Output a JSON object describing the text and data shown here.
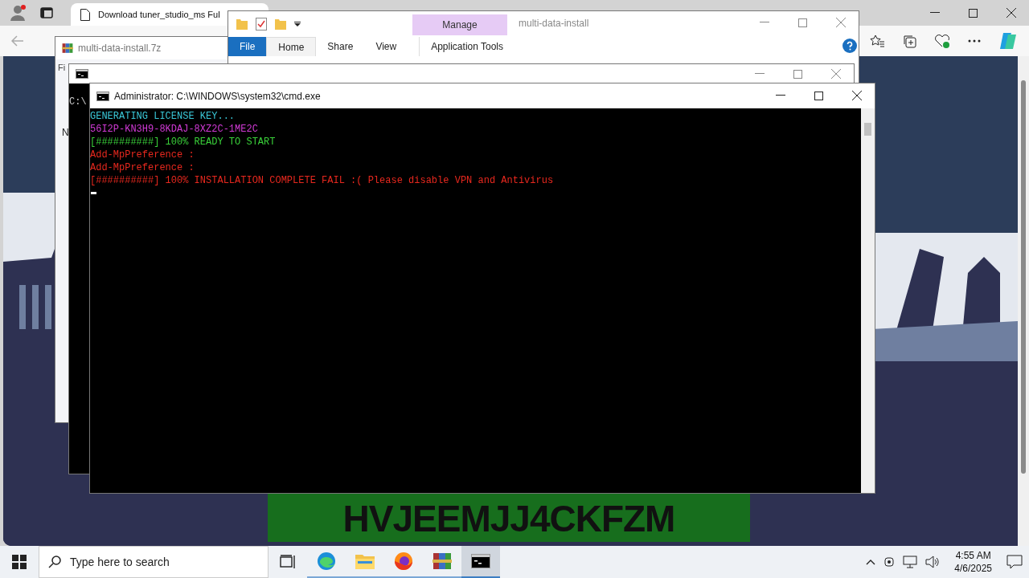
{
  "browser": {
    "tab": {
      "title": "Download tuner_studio_ms Ful"
    },
    "banner": {
      "text": "HVJEEMJJ4CKFZM"
    }
  },
  "archive_window": {
    "title": "multi-data-install.7z",
    "menu": "Fi",
    "column_1": "N"
  },
  "explorer_window": {
    "title": "multi-data-install",
    "context_tab": "Manage",
    "ribbon_tabs": [
      {
        "label": "File",
        "kind": "file",
        "selected": false
      },
      {
        "label": "Home",
        "kind": "tab",
        "selected": true
      },
      {
        "label": "Share",
        "kind": "tab",
        "selected": false
      },
      {
        "label": "View",
        "kind": "tab",
        "selected": false
      },
      {
        "label": "Application Tools",
        "kind": "context",
        "selected": false
      }
    ]
  },
  "back_console": {
    "text": "C:\\"
  },
  "console": {
    "title": "Administrator: C:\\WINDOWS\\system32\\cmd.exe",
    "lines": [
      {
        "text": "GENERATING LICENSE KEY...",
        "color": "#3ac8d8"
      },
      {
        "text": "56I2P-KN3H9-8KDAJ-8XZ2C-1ME2C",
        "color": "#d23ad6"
      },
      {
        "text": "[##########] 100% READY TO START",
        "color": "#3ad23a"
      },
      {
        "text": "Add-MpPreference :",
        "color": "#e8281e"
      },
      {
        "text": "Add-MpPreference :",
        "color": "#e8281e"
      },
      {
        "text": "[##########] 100% INSTALLATION COMPLETE FAIL :( Please disable VPN and Antivirus",
        "color": "#e8281e"
      }
    ]
  },
  "taskbar": {
    "search": {
      "placeholder": "Type here to search"
    },
    "apps": [
      {
        "kind": "edge",
        "selected": false
      },
      {
        "kind": "folder",
        "selected": false
      },
      {
        "kind": "firefox",
        "selected": false
      },
      {
        "kind": "archive",
        "selected": false
      },
      {
        "kind": "console",
        "selected": true
      }
    ],
    "time": "4:55 AM",
    "date": "4/6/2025"
  }
}
